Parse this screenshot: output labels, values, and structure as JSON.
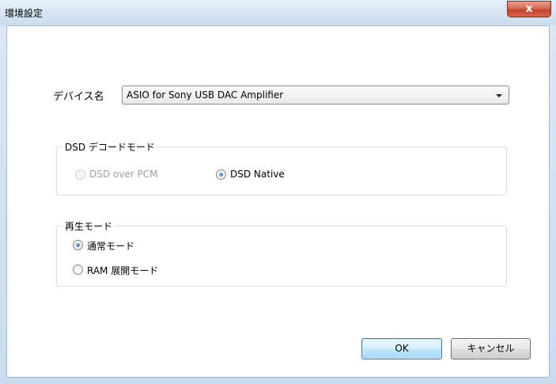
{
  "window": {
    "title": "環境設定",
    "close_label": "x"
  },
  "device": {
    "label": "デバイス名",
    "selected": "ASIO for Sony USB DAC Amplifier"
  },
  "dsd_group": {
    "title": "DSD デコードモード",
    "options": [
      {
        "label": "DSD over PCM",
        "checked": false,
        "enabled": false
      },
      {
        "label": "DSD Native",
        "checked": true,
        "enabled": true
      }
    ]
  },
  "playback_group": {
    "title": "再生モード",
    "options": [
      {
        "label": "通常モード",
        "checked": true,
        "enabled": true
      },
      {
        "label": "RAM 展開モード",
        "checked": false,
        "enabled": true
      }
    ]
  },
  "buttons": {
    "ok": "OK",
    "cancel": "キャンセル"
  },
  "colors": {
    "accent": "#2b66b8",
    "close": "#c24329"
  }
}
